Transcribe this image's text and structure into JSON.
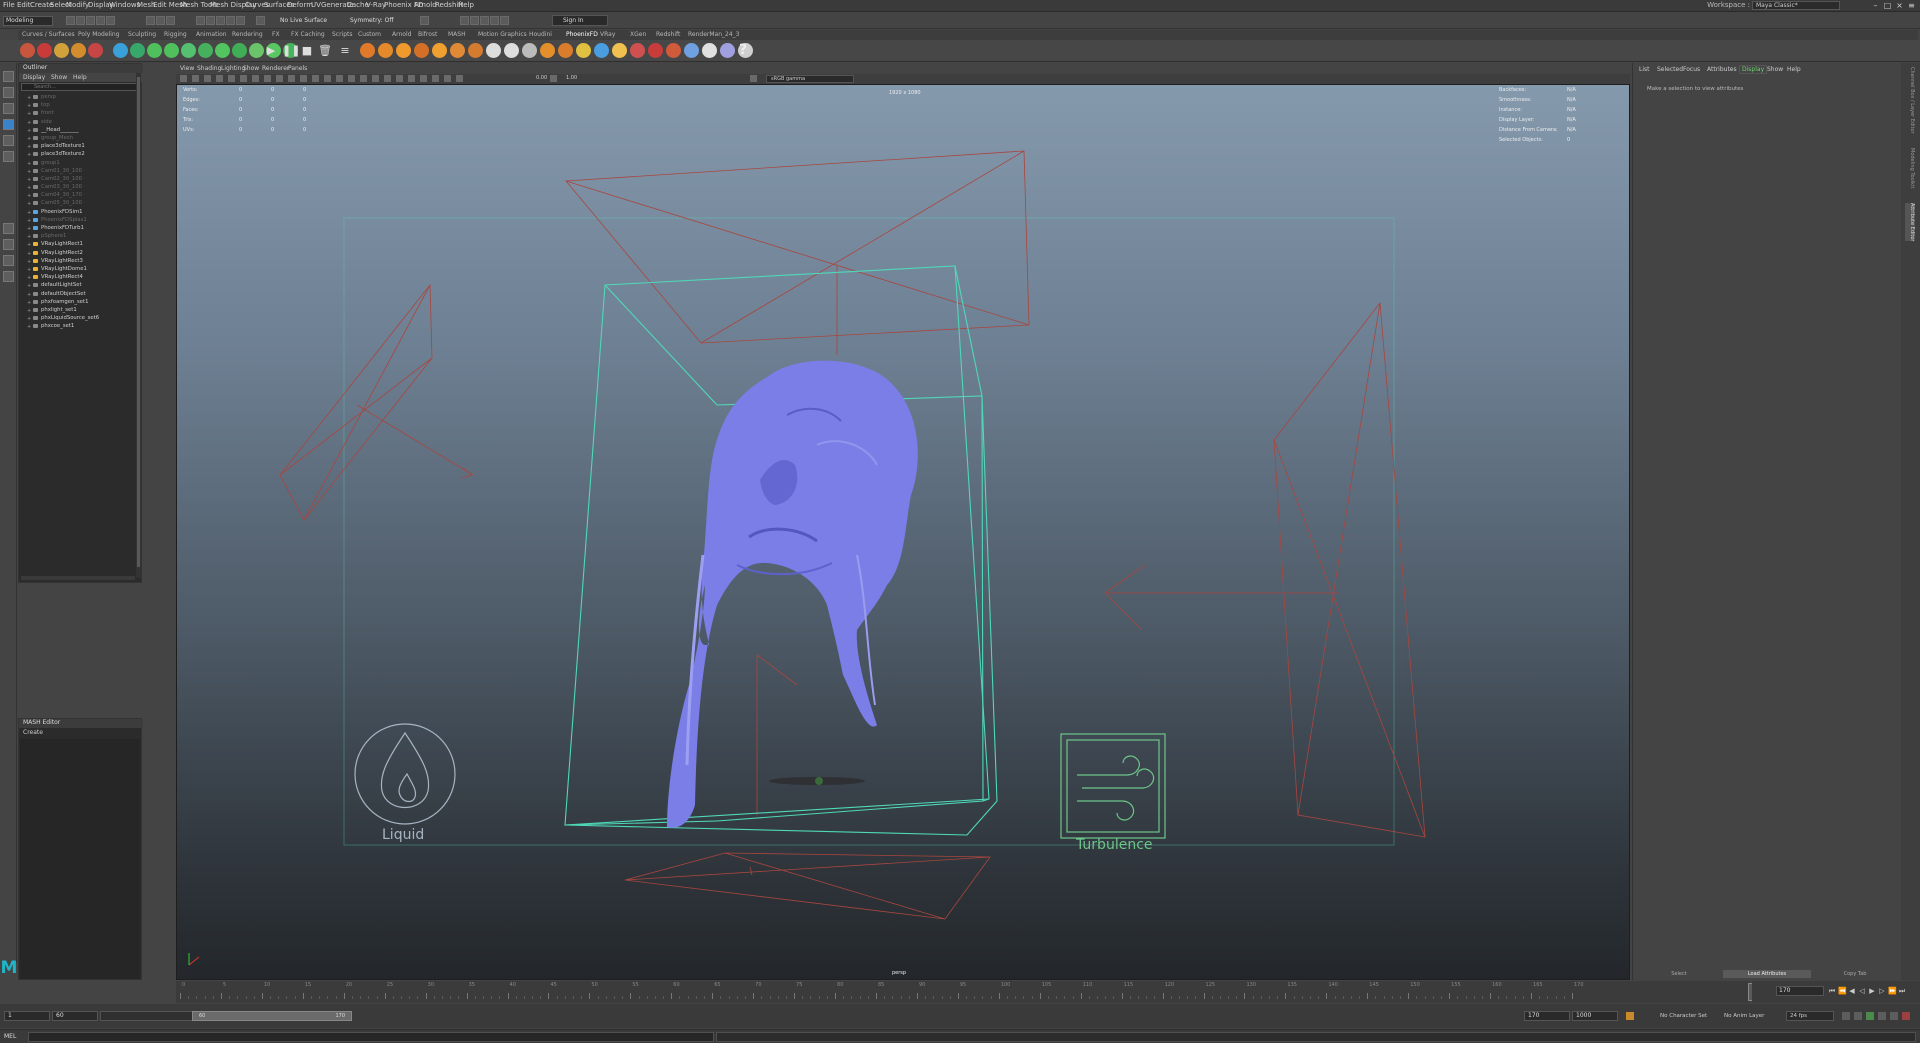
{
  "menubar": {
    "items": [
      "File",
      "Edit",
      "Create",
      "Select",
      "Modify",
      "Display",
      "Windows",
      "Mesh",
      "Edit Mesh",
      "Mesh Tools",
      "Mesh Display",
      "Curves",
      "Surfaces",
      "Deform",
      "UV",
      "Generate",
      "Cache",
      "V-Ray",
      "Phoenix FD",
      "Arnold",
      "Redshift",
      "Help"
    ],
    "workspace_label": "Workspace :",
    "workspace_value": "Maya Classic*"
  },
  "statusline": {
    "mode": "Modeling",
    "live_surface": "No Live Surface",
    "symmetry": "Symmetry: Off",
    "sign_in": "Sign In"
  },
  "shelf": {
    "tabs": [
      "Curves / Surfaces",
      "Poly Modeling",
      "Sculpting",
      "Rigging",
      "Animation",
      "Rendering",
      "FX",
      "FX Caching",
      "Scripts",
      "Custom",
      "Arnold",
      "Bifrost",
      "MASH",
      "Motion Graphics",
      "Houdini",
      "PhoenixFD",
      "VRay",
      "XGen",
      "Redshift",
      "RenderMan_24_3"
    ],
    "active_tab": "PhoenixFD"
  },
  "outliner": {
    "title": "Outliner",
    "menu": [
      "Display",
      "Show",
      "Help"
    ],
    "search_placeholder": "Search...",
    "items": [
      {
        "label": "persp",
        "state": "dim"
      },
      {
        "label": "top",
        "state": "dim"
      },
      {
        "label": "front",
        "state": "dim"
      },
      {
        "label": "side",
        "state": "dim"
      },
      {
        "label": "__Head_______",
        "state": "bright"
      },
      {
        "label": "group_Mesh",
        "state": "dim"
      },
      {
        "label": "place3dTexture1",
        "state": "bright"
      },
      {
        "label": "place3dTexture2",
        "state": "bright"
      },
      {
        "label": "group1",
        "state": "dim"
      },
      {
        "label": "Cam01_30_100",
        "state": "dim"
      },
      {
        "label": "Cam02_30_100",
        "state": "dim"
      },
      {
        "label": "Cam03_30_100",
        "state": "dim"
      },
      {
        "label": "Cam04_30_170",
        "state": "dim"
      },
      {
        "label": "Cam05_30_100",
        "state": "dim"
      },
      {
        "label": "PhoenixFDSim1",
        "state": "bright"
      },
      {
        "label": "PhoenixFDSplas1",
        "state": "dim"
      },
      {
        "label": "PhoenixFDTurb1",
        "state": "bright"
      },
      {
        "label": "pSphere1",
        "state": "dim"
      },
      {
        "label": "VRayLightRect1",
        "state": "bright"
      },
      {
        "label": "VRayLightRect2",
        "state": "bright"
      },
      {
        "label": "VRayLightRect3",
        "state": "bright"
      },
      {
        "label": "VRayLightDome1",
        "state": "bright"
      },
      {
        "label": "VRayLightRect4",
        "state": "bright"
      },
      {
        "label": "defaultLightSet",
        "state": "bright"
      },
      {
        "label": "defaultObjectSet",
        "state": "bright"
      },
      {
        "label": "phxfoamgen_set1",
        "state": "bright"
      },
      {
        "label": "phxlight_set1",
        "state": "bright"
      },
      {
        "label": "phxLiquidSource_set6",
        "state": "bright"
      },
      {
        "label": "phxcoe_set1",
        "state": "bright"
      }
    ]
  },
  "mash": {
    "title": "MASH Editor",
    "create": "Create"
  },
  "viewport": {
    "menu": [
      "View",
      "Shading",
      "Lighting",
      "Show",
      "Renderer",
      "Panels"
    ],
    "exposure": "0.00",
    "gamma": "1.00",
    "color_space": "sRGB gamma",
    "resolution": "1920 x 1080",
    "camera": "persp",
    "hud_left": [
      {
        "label": "Verts:",
        "v1": "0",
        "v2": "0",
        "v3": "0"
      },
      {
        "label": "Edges:",
        "v1": "0",
        "v2": "0",
        "v3": "0"
      },
      {
        "label": "Faces:",
        "v1": "0",
        "v2": "0",
        "v3": "0"
      },
      {
        "label": "Tris:",
        "v1": "0",
        "v2": "0",
        "v3": "0"
      },
      {
        "label": "UVs:",
        "v1": "0",
        "v2": "0",
        "v3": "0"
      }
    ],
    "hud_right": [
      {
        "label": "Backfaces:",
        "value": "N/A"
      },
      {
        "label": "Smoothness:",
        "value": "N/A"
      },
      {
        "label": "Instance:",
        "value": "N/A"
      },
      {
        "label": "Display Layer:",
        "value": "N/A"
      },
      {
        "label": "Distance From Camera:",
        "value": "N/A"
      },
      {
        "label": "Selected Objects:",
        "value": "0"
      }
    ],
    "liquid_label": "Liquid",
    "turbulence_label": "Turbulence",
    "colors": {
      "mesh": "#7b7ee6",
      "sim_box": "#4fd8b8",
      "camera_lines": "#a8463f",
      "icon_liquid": "#a7b4c2",
      "icon_turbulence": "#6ec58a"
    }
  },
  "attribute_editor": {
    "menu": [
      "List",
      "Selected",
      "Focus",
      "Attributes",
      "Display",
      "Show",
      "Help"
    ],
    "active_menu": "Display",
    "message": "Make a selection to view attributes",
    "buttons": [
      "Select",
      "Load Attributes",
      "Copy Tab"
    ],
    "side_tabs": [
      "Channel Box / Layer Editor",
      "Modeling Toolkit",
      "Attribute Editor"
    ]
  },
  "timeslider": {
    "labels": [
      "0",
      "5",
      "10",
      "15",
      "20",
      "25",
      "30",
      "35",
      "40",
      "45",
      "50",
      "55",
      "60",
      "65",
      "70",
      "75",
      "80",
      "85",
      "90",
      "95",
      "100",
      "105",
      "110",
      "115",
      "120",
      "125",
      "130",
      "135",
      "140",
      "145",
      "150",
      "155",
      "160",
      "165",
      "170"
    ],
    "current_frame": "170"
  },
  "rangebar": {
    "start": "1",
    "anim_start": "60",
    "range_start": "60",
    "range_end": "170",
    "anim_end": "170",
    "end": "1000",
    "character_set": "No Character Set",
    "anim_layer": "No Anim Layer",
    "fps": "24 fps"
  },
  "cmdline": {
    "label": "MEL"
  }
}
